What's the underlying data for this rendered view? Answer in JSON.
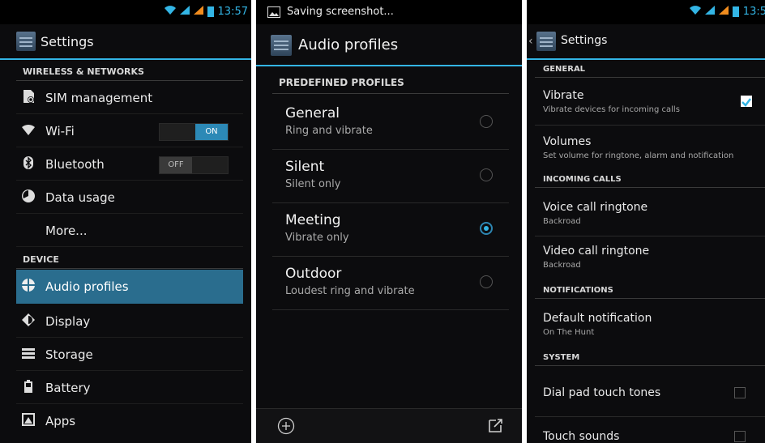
{
  "panel1": {
    "clock": "13:57",
    "title": "Settings",
    "sections": [
      "WIRELESS & NETWORKS",
      "DEVICE"
    ],
    "items": [
      {
        "label": "SIM management",
        "icon": "sim-icon"
      },
      {
        "label": "Wi-Fi",
        "icon": "wifi-icon",
        "toggle": "ON"
      },
      {
        "label": "Bluetooth",
        "icon": "bluetooth-icon",
        "toggle": "OFF"
      },
      {
        "label": "Data usage",
        "icon": "data-usage-icon"
      },
      {
        "label": "More...",
        "icon": ""
      },
      {
        "label": "Audio profiles",
        "icon": "audio-profiles-icon",
        "selected": true
      },
      {
        "label": "Display",
        "icon": "display-icon"
      },
      {
        "label": "Storage",
        "icon": "storage-icon"
      },
      {
        "label": "Battery",
        "icon": "battery-icon"
      },
      {
        "label": "Apps",
        "icon": "apps-icon"
      }
    ]
  },
  "panel2": {
    "notification": "Saving screenshot...",
    "title": "Audio profiles",
    "section": "PREDEFINED PROFILES",
    "profiles": [
      {
        "name": "General",
        "desc": "Ring and vibrate",
        "selected": false
      },
      {
        "name": "Silent",
        "desc": "Silent only",
        "selected": false
      },
      {
        "name": "Meeting",
        "desc": "Vibrate only",
        "selected": true
      },
      {
        "name": "Outdoor",
        "desc": "Loudest ring and vibrate",
        "selected": false
      }
    ]
  },
  "panel3": {
    "clock": "13:5",
    "title": "Settings",
    "general": "GENERAL",
    "vibrate": {
      "title": "Vibrate",
      "sub": "Vibrate devices for incoming calls",
      "checked": true
    },
    "volumes": {
      "title": "Volumes",
      "sub": "Set volume for ringtone, alarm and notification"
    },
    "incoming": "INCOMING CALLS",
    "voice": {
      "title": "Voice call ringtone",
      "sub": "Backroad"
    },
    "video": {
      "title": "Video call ringtone",
      "sub": "Backroad"
    },
    "notifications": "NOTIFICATIONS",
    "default_notif": {
      "title": "Default notification",
      "sub": "On The Hunt"
    },
    "system": "SYSTEM",
    "dialpad": {
      "title": "Dial pad touch tones",
      "checked": false
    },
    "touch": {
      "title": "Touch sounds",
      "checked": false
    }
  },
  "colors": {
    "accent": "#33b5e5",
    "selected_bg": "#2a6d8e"
  }
}
